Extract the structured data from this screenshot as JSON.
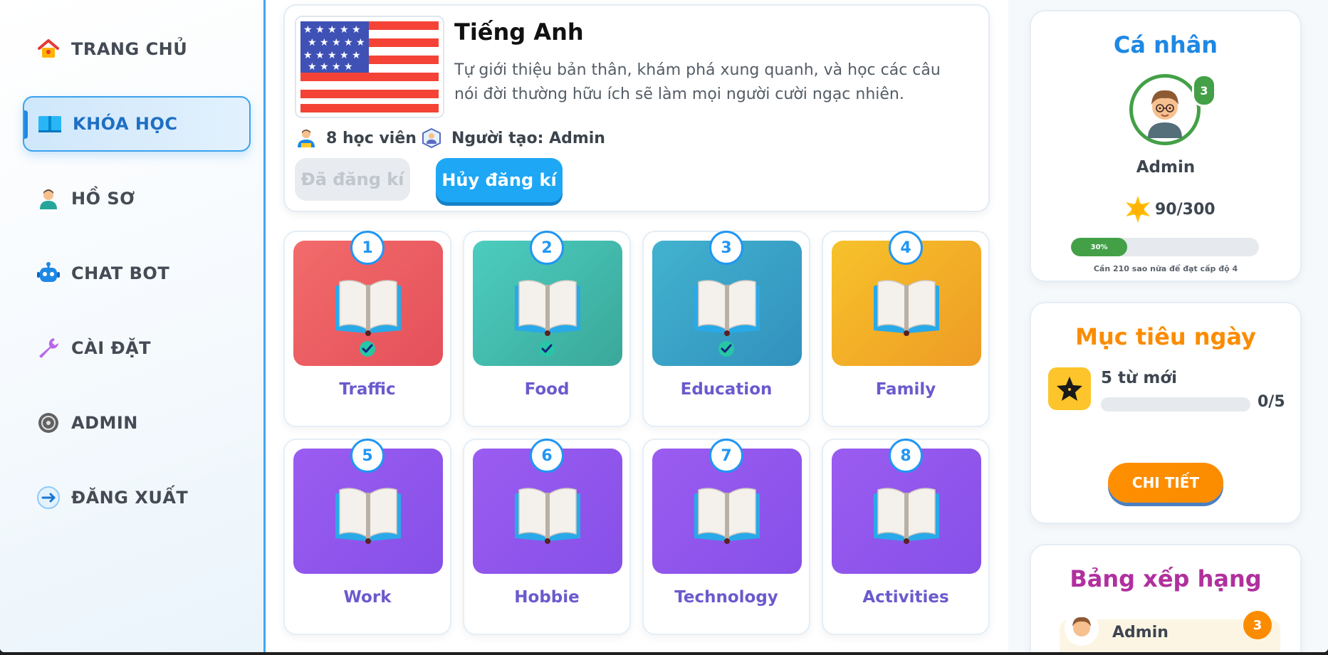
{
  "sidebar": {
    "items": [
      {
        "label": "TRANG CHỦ",
        "icon": "home-icon"
      },
      {
        "label": "KHÓA HỌC",
        "icon": "book-icon",
        "active": true
      },
      {
        "label": "HỒ SƠ",
        "icon": "profile-icon"
      },
      {
        "label": "CHAT BOT",
        "icon": "robot-icon"
      },
      {
        "label": "CÀI ĐẶT",
        "icon": "wrench-icon"
      },
      {
        "label": "ADMIN",
        "icon": "admin-icon"
      },
      {
        "label": "ĐĂNG XUẤT",
        "icon": "logout-icon"
      }
    ]
  },
  "course": {
    "title": "Tiếng Anh",
    "description": "Tự giới thiệu bản thân, khám phá xung quanh, và học các câu nói đời thường hữu ích sẽ làm mọi người cười ngạc nhiên.",
    "students": "8 học viên",
    "creator": "Người tạo: Admin",
    "registered_label": "Đã đăng kí",
    "cancel_label": "Hủy đăng kí"
  },
  "lessons": [
    {
      "number": "1",
      "name": "Traffic",
      "completed": true,
      "color_from": "#f26b6b",
      "color_to": "#e4505a"
    },
    {
      "number": "2",
      "name": "Food",
      "completed": true,
      "color_from": "#4ccdbf",
      "color_to": "#3aa89a"
    },
    {
      "number": "3",
      "name": "Education",
      "completed": true,
      "color_from": "#42b2cf",
      "color_to": "#3191bd"
    },
    {
      "number": "4",
      "name": "Family",
      "completed": false,
      "color_from": "#f7c22a",
      "color_to": "#ee9b25"
    },
    {
      "number": "5",
      "name": "Work",
      "completed": false,
      "color_from": "#9b5cf0",
      "color_to": "#8650e8"
    },
    {
      "number": "6",
      "name": "Hobbie",
      "completed": false,
      "color_from": "#9b5cf0",
      "color_to": "#8650e8"
    },
    {
      "number": "7",
      "name": "Technology",
      "completed": false,
      "color_from": "#9b5cf0",
      "color_to": "#8650e8"
    },
    {
      "number": "8",
      "name": "Activities",
      "completed": false,
      "color_from": "#9b5cf0",
      "color_to": "#8650e8"
    }
  ],
  "profile": {
    "title": "Cá nhân",
    "level": "3",
    "name": "Admin",
    "stars": "90/300",
    "progress_label": "30%",
    "progress": 0.3,
    "note": "Cần 210 sao nữa để đạt cấp độ 4"
  },
  "daily_goal": {
    "title": "Mục tiêu ngày",
    "label": "5 từ mới",
    "count": "0/5",
    "progress": 0,
    "detail_label": "CHI TIẾT"
  },
  "leaderboard": {
    "title": "Bảng xếp hạng",
    "entries": [
      {
        "name": "Admin",
        "level": "3"
      }
    ]
  },
  "colors": {
    "accent": "#42a5f5",
    "profile_title": "#1e88e5",
    "goal_title": "#fb8c00",
    "leader_title": "#b0309e",
    "lesson_name": "#6a5acd"
  }
}
